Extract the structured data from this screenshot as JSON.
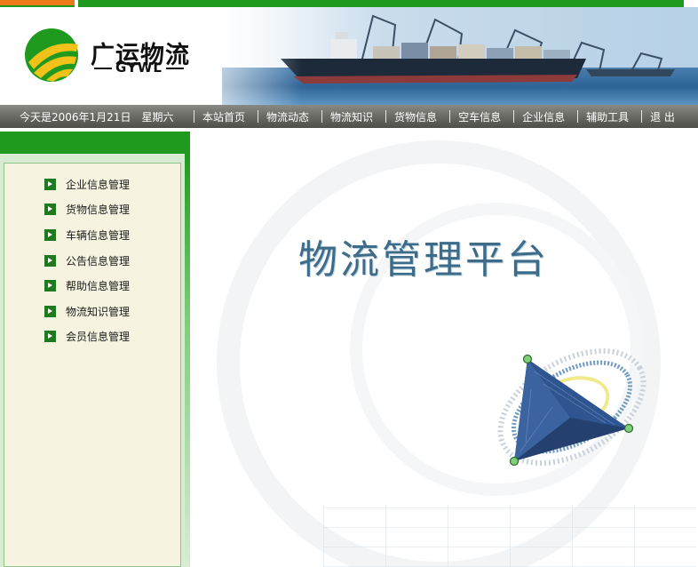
{
  "header": {
    "logo_title": "广运物流",
    "logo_sub": "GYWL"
  },
  "nav": {
    "date": "今天是2006年1月21日　星期六",
    "items": [
      {
        "label": "本站首页"
      },
      {
        "label": "物流动态"
      },
      {
        "label": "物流知识"
      },
      {
        "label": "货物信息"
      },
      {
        "label": "空车信息"
      },
      {
        "label": "企业信息"
      },
      {
        "label": "辅助工具"
      },
      {
        "label": "退 出"
      }
    ]
  },
  "sidebar": {
    "items": [
      {
        "label": "企业信息管理"
      },
      {
        "label": "货物信息管理"
      },
      {
        "label": "车辆信息管理"
      },
      {
        "label": "公告信息管理"
      },
      {
        "label": "帮助信息管理"
      },
      {
        "label": "物流知识管理"
      },
      {
        "label": "会员信息管理"
      }
    ]
  },
  "main": {
    "title": "物流管理平台"
  },
  "colors": {
    "brand_green": "#1f9a1f",
    "accent_orange": "#f07a1a",
    "title_blue": "#3d6c8a"
  }
}
